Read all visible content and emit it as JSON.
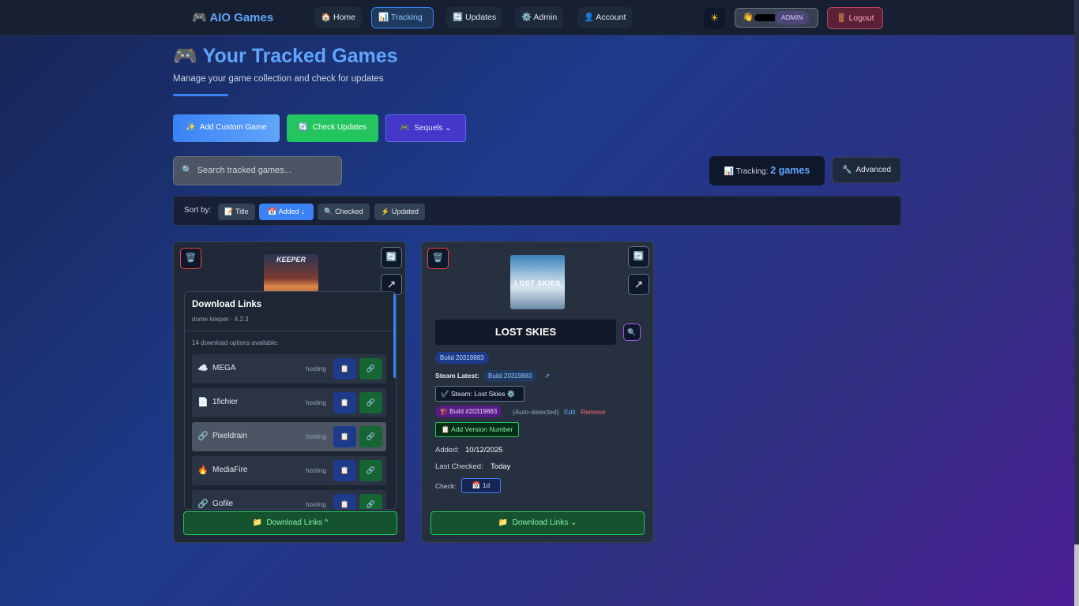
{
  "nav": {
    "brand_icon": "🎮",
    "brand": "AIO Games",
    "links": [
      {
        "icon": "🏠",
        "label": "Home"
      },
      {
        "icon": "📊",
        "label": "Tracking"
      },
      {
        "icon": "🔄",
        "label": "Updates"
      },
      {
        "icon": "⚙️",
        "label": "Admin"
      },
      {
        "icon": "👤",
        "label": "Account"
      }
    ],
    "active": "Tracking",
    "theme_icon": "☀",
    "user_wave": "👋",
    "role_badge": "ADMIN",
    "logout_icon": "🚪",
    "logout": "Logout"
  },
  "header": {
    "icon": "🎮",
    "title": "Your Tracked Games",
    "subtitle": "Manage your game collection and check for updates"
  },
  "actions": {
    "add_custom": {
      "icon": "✨",
      "label": "Add Custom Game"
    },
    "check_updates": {
      "icon": "🔄",
      "label": "Check Updates"
    },
    "sequels": {
      "icon": "🎮",
      "label": "Sequels",
      "caret": "⌄"
    }
  },
  "search": {
    "icon": "🔍",
    "placeholder": "Search tracked games..."
  },
  "tracking": {
    "icon": "📊",
    "label": "Tracking:",
    "count": "2 games"
  },
  "advanced": {
    "icon": "🔧",
    "label": "Advanced"
  },
  "sort": {
    "label": "Sort by:",
    "options": [
      {
        "icon": "📝",
        "label": "Title"
      },
      {
        "icon": "📅",
        "label": "Added ↓"
      },
      {
        "icon": "🔍",
        "label": "Checked"
      },
      {
        "icon": "⚡",
        "label": "Updated"
      }
    ],
    "active": "Added"
  },
  "cards": [
    {
      "title": "dome keeper",
      "cover_text": "KEEPER",
      "download_panel": {
        "title": "Download Links",
        "subtitle": "dome keeper - 4.2.3",
        "count_text": "14 download options available:",
        "hosts": [
          {
            "icon": "☁️",
            "name": "MEGA",
            "type": "hosting"
          },
          {
            "icon": "📄",
            "name": "1fichier",
            "type": "hosting"
          },
          {
            "icon": "🔗",
            "name": "Pixeldrain",
            "type": "hosting"
          },
          {
            "icon": "🔥",
            "name": "MediaFire",
            "type": "hosting"
          },
          {
            "icon": "🔗",
            "name": "Gofile",
            "type": "hosting"
          }
        ]
      },
      "download_button": {
        "icon": "📁",
        "label": "Download Links",
        "caret": "^"
      }
    },
    {
      "title": "LOST SKIES",
      "cover_text": "LOST SKIES",
      "build": "Build 20319883",
      "steam_latest_label": "Steam Latest:",
      "steam_latest_build": "Build 20319883",
      "steam_link": "✔️ Steam: Lost Skies",
      "build_detect": "🏗️ Build #20319883",
      "auto_detected": "(Auto-detected)",
      "edit": "Edit",
      "remove": "Remove",
      "add_version": "📋 Add Version Number",
      "added_label": "Added:",
      "added_value": "10/12/2025",
      "last_checked_label": "Last Checked:",
      "last_checked_value": "Today",
      "check_label": "Check:",
      "check_value": "📅 1d",
      "download_button": {
        "icon": "📁",
        "label": "Download Links",
        "caret": "⌄"
      }
    }
  ],
  "icons": {
    "trash": "🗑️",
    "refresh": "🔄",
    "external": "↗",
    "copy": "📋",
    "link": "🔗",
    "search": "🔍",
    "gear": "⚙️",
    "external_small": "⇗"
  }
}
